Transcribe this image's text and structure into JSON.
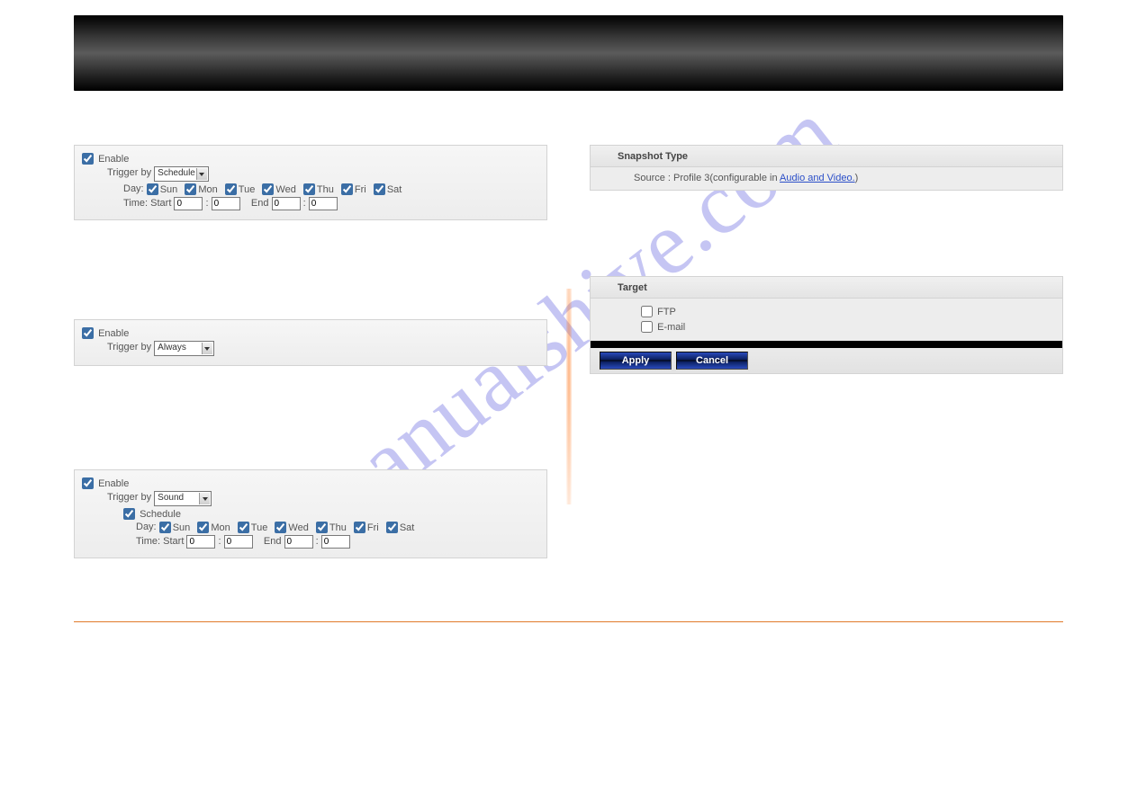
{
  "watermark": "manualshive.com",
  "left": {
    "panel1": {
      "enable_label": "Enable",
      "enable_checked": true,
      "trigger_label": "Trigger by",
      "trigger_value": "Schedule",
      "days_label": "Day:",
      "days": [
        {
          "label": "Sun",
          "checked": true
        },
        {
          "label": "Mon",
          "checked": true
        },
        {
          "label": "Tue",
          "checked": true
        },
        {
          "label": "Wed",
          "checked": true
        },
        {
          "label": "Thu",
          "checked": true
        },
        {
          "label": "Fri",
          "checked": true
        },
        {
          "label": "Sat",
          "checked": true
        }
      ],
      "time_label": "Time: Start",
      "start_h": "0",
      "start_m": "0",
      "end_label": "End",
      "end_h": "0",
      "end_m": "0"
    },
    "panel2": {
      "enable_label": "Enable",
      "enable_checked": true,
      "trigger_label": "Trigger by",
      "trigger_value": "Always"
    },
    "panel3": {
      "enable_label": "Enable",
      "enable_checked": true,
      "trigger_label": "Trigger by",
      "trigger_value": "Sound",
      "schedule_label": "Schedule",
      "schedule_checked": true,
      "days_label": "Day:",
      "days": [
        {
          "label": "Sun",
          "checked": true
        },
        {
          "label": "Mon",
          "checked": true
        },
        {
          "label": "Tue",
          "checked": true
        },
        {
          "label": "Wed",
          "checked": true
        },
        {
          "label": "Thu",
          "checked": true
        },
        {
          "label": "Fri",
          "checked": true
        },
        {
          "label": "Sat",
          "checked": true
        }
      ],
      "time_label": "Time: Start",
      "start_h": "0",
      "start_m": "0",
      "end_label": "End",
      "end_h": "0",
      "end_m": "0"
    }
  },
  "right": {
    "snapshot": {
      "header": "Snapshot Type",
      "source_prefix": "Source : Profile 3(configurable in ",
      "link_text": "Audio and Video.",
      "source_suffix": ")"
    },
    "target": {
      "header": "Target",
      "ftp_label": "FTP",
      "ftp_checked": false,
      "email_label": "E-mail",
      "email_checked": false
    },
    "buttons": {
      "apply": "Apply",
      "cancel": "Cancel"
    }
  }
}
